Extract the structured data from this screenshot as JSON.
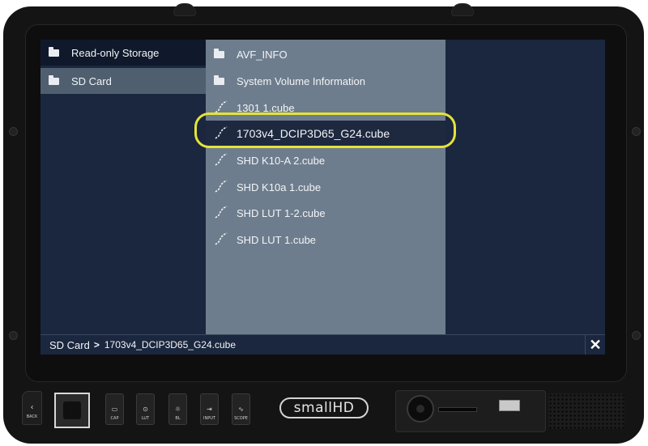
{
  "colors": {
    "screen_bg": "#1b273e",
    "list_panel_bg": "#6e7d8d",
    "selection_dark": "#1e2940",
    "selection_light": "#4f5f70",
    "highlight_ring": "#e4e33a"
  },
  "storage_list": [
    {
      "label": "Read-only Storage",
      "icon": "folder-icon",
      "selected": false
    },
    {
      "label": "SD Card",
      "icon": "folder-icon",
      "selected": true
    }
  ],
  "file_list": [
    {
      "label": "AVF_INFO",
      "icon": "folder-icon",
      "selected": false
    },
    {
      "label": "System Volume Information",
      "icon": "folder-icon",
      "selected": false
    },
    {
      "label": "1301 1.cube",
      "icon": "lut-curve-icon",
      "selected": false
    },
    {
      "label": "1703v4_DCIP3D65_G24.cube",
      "icon": "lut-curve-icon",
      "selected": true
    },
    {
      "label": "SHD K10-A 2.cube",
      "icon": "lut-curve-icon",
      "selected": false
    },
    {
      "label": "SHD K10a 1.cube",
      "icon": "lut-curve-icon",
      "selected": false
    },
    {
      "label": "SHD LUT 1-2.cube",
      "icon": "lut-curve-icon",
      "selected": false
    },
    {
      "label": "SHD LUT 1.cube",
      "icon": "lut-curve-icon",
      "selected": false
    }
  ],
  "path_bar": {
    "root": "SD Card",
    "separator": ">",
    "file": "1703v4_DCIP3D65_G24.cube",
    "close_icon": "close-icon"
  },
  "hardware": {
    "back_label": "BACK",
    "buttons": [
      {
        "label": "CAP",
        "icon": "capture-icon"
      },
      {
        "label": "LUT",
        "icon": "lut-icon"
      },
      {
        "label": "BL",
        "icon": "backlight-icon"
      },
      {
        "label": "INPUT",
        "icon": "input-icon"
      },
      {
        "label": "SCOPE",
        "icon": "scope-icon"
      }
    ],
    "brand": "smallHD"
  }
}
